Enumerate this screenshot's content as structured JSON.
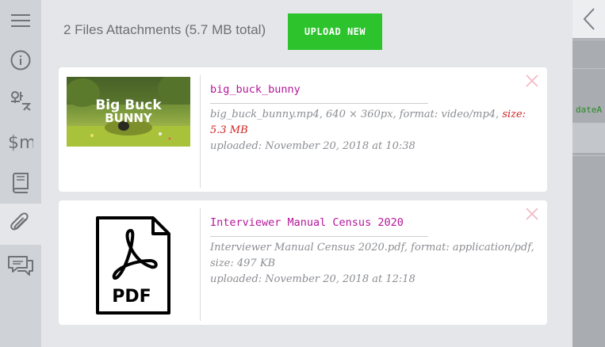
{
  "header": {
    "title": "2 Files Attachments (5.7 MB total)",
    "upload_label": "UPLOAD NEW"
  },
  "sidebar": {
    "items": [
      {
        "name": "menu",
        "icon": "hamburger-menu-icon"
      },
      {
        "name": "info",
        "icon": "info-icon"
      },
      {
        "name": "translate",
        "icon": "translate-icon"
      },
      {
        "name": "currency",
        "icon": "currency-icon"
      },
      {
        "name": "book",
        "icon": "book-icon"
      },
      {
        "name": "attachments",
        "icon": "paperclip-icon",
        "active": true
      },
      {
        "name": "comments",
        "icon": "chat-icon"
      }
    ]
  },
  "files": [
    {
      "title": "big_buck_bunny",
      "meta_line1": "big_buck_bunny.mp4,  640 × 360px,  format: video/mp4,",
      "size_text": "size: 5.3 MB",
      "uploaded": "uploaded: November 20, 2018 at 10:38",
      "thumb_text_1": "Big Buck",
      "thumb_text_2": "BUNNY",
      "type": "video"
    },
    {
      "title": "Interviewer Manual Census 2020",
      "meta_line1": "Interviewer Manual Census 2020.pdf,  format: application/pdf,",
      "size_text": "size: 497 KB",
      "uploaded": "uploaded: November 20, 2018 at 12:18",
      "thumb_label": "PDF",
      "type": "pdf"
    }
  ],
  "right_panel": {
    "code_text": "dateA"
  },
  "colors": {
    "accent_green": "#2cc32c",
    "title_magenta": "#b5169a",
    "size_red": "#d22020",
    "close_pink": "#f2b8c4"
  }
}
